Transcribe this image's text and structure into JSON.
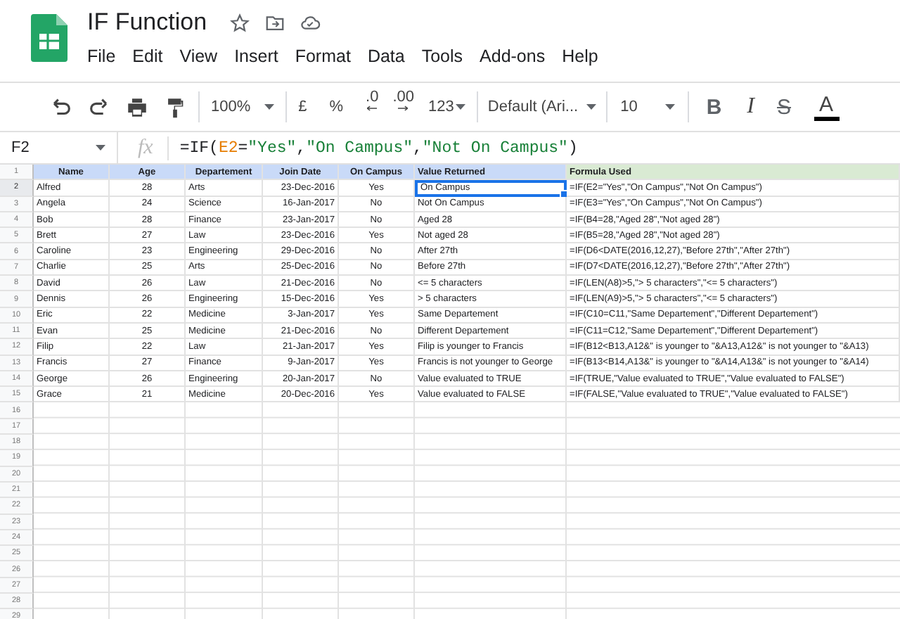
{
  "window": {
    "title": "IF Function"
  },
  "menu": [
    "File",
    "Edit",
    "View",
    "Insert",
    "Format",
    "Data",
    "Tools",
    "Add-ons",
    "Help"
  ],
  "toolbar": {
    "zoom": "100%",
    "currency": "£",
    "percent": "%",
    "decimal_decrease": ".0",
    "decimal_increase": ".00",
    "number_format": "123",
    "font": "Default (Ari...",
    "font_size": "10",
    "bold": "B",
    "italic": "I",
    "strikethrough": "S",
    "text_color": "A"
  },
  "formula_bar": {
    "cell_ref": "F2",
    "fx": "fx",
    "tokens": [
      {
        "kind": "plain",
        "text": "=IF("
      },
      {
        "kind": "ref",
        "text": "E2"
      },
      {
        "kind": "plain",
        "text": "="
      },
      {
        "kind": "string",
        "text": "\"Yes\""
      },
      {
        "kind": "plain",
        "text": ","
      },
      {
        "kind": "string",
        "text": "\"On Campus\""
      },
      {
        "kind": "plain",
        "text": ","
      },
      {
        "kind": "string",
        "text": "\"Not On Campus\""
      },
      {
        "kind": "plain",
        "text": ")"
      }
    ]
  },
  "sheet": {
    "header_row": "1",
    "columns": [
      {
        "label": "Name",
        "kind": "text",
        "color": "#c9daf8"
      },
      {
        "label": "Age",
        "kind": "number",
        "color": "#c9daf8"
      },
      {
        "label": "Departement",
        "kind": "text",
        "color": "#c9daf8"
      },
      {
        "label": "Join Date",
        "kind": "date",
        "color": "#c9daf8"
      },
      {
        "label": "On Campus",
        "kind": "flag",
        "color": "#c9daf8"
      },
      {
        "label": "Value Returned",
        "kind": "result",
        "color": "#c9daf8"
      },
      {
        "label": "Formula Used",
        "kind": "formula",
        "color": "#d9ead3"
      }
    ],
    "rows": [
      {
        "number": "2",
        "cells": [
          {
            "text": "Alfred",
            "selected": false
          },
          {
            "text": "28",
            "selected": false
          },
          {
            "text": "Arts",
            "selected": false
          },
          {
            "text": "23-Dec-2016",
            "selected": false
          },
          {
            "text": "Yes",
            "selected": false
          },
          {
            "text": "On Campus",
            "selected": true
          },
          {
            "text": "=IF(E2=\"Yes\",\"On Campus\",\"Not On Campus\")",
            "selected": false
          }
        ]
      },
      {
        "number": "3",
        "cells": [
          {
            "text": "Angela",
            "selected": false
          },
          {
            "text": "24",
            "selected": false
          },
          {
            "text": "Science",
            "selected": false
          },
          {
            "text": "16-Jan-2017",
            "selected": false
          },
          {
            "text": "No",
            "selected": false
          },
          {
            "text": "Not On Campus",
            "selected": false
          },
          {
            "text": "=IF(E3=\"Yes\",\"On Campus\",\"Not On Campus\")",
            "selected": false
          }
        ]
      },
      {
        "number": "4",
        "cells": [
          {
            "text": "Bob",
            "selected": false
          },
          {
            "text": "28",
            "selected": false
          },
          {
            "text": "Finance",
            "selected": false
          },
          {
            "text": "23-Jan-2017",
            "selected": false
          },
          {
            "text": "No",
            "selected": false
          },
          {
            "text": "Aged 28",
            "selected": false
          },
          {
            "text": "=IF(B4=28,\"Aged 28\",\"Not aged 28\")",
            "selected": false
          }
        ]
      },
      {
        "number": "5",
        "cells": [
          {
            "text": "Brett",
            "selected": false
          },
          {
            "text": "27",
            "selected": false
          },
          {
            "text": "Law",
            "selected": false
          },
          {
            "text": "23-Dec-2016",
            "selected": false
          },
          {
            "text": "Yes",
            "selected": false
          },
          {
            "text": "Not aged 28",
            "selected": false
          },
          {
            "text": "=IF(B5=28,\"Aged 28\",\"Not aged 28\")",
            "selected": false
          }
        ]
      },
      {
        "number": "6",
        "cells": [
          {
            "text": "Caroline",
            "selected": false
          },
          {
            "text": "23",
            "selected": false
          },
          {
            "text": "Engineering",
            "selected": false
          },
          {
            "text": "29-Dec-2016",
            "selected": false
          },
          {
            "text": "No",
            "selected": false
          },
          {
            "text": "After 27th",
            "selected": false
          },
          {
            "text": "=IF(D6<DATE(2016,12,27),\"Before 27th\",\"After 27th\")",
            "selected": false
          }
        ]
      },
      {
        "number": "7",
        "cells": [
          {
            "text": "Charlie",
            "selected": false
          },
          {
            "text": "25",
            "selected": false
          },
          {
            "text": "Arts",
            "selected": false
          },
          {
            "text": "25-Dec-2016",
            "selected": false
          },
          {
            "text": "No",
            "selected": false
          },
          {
            "text": "Before 27th",
            "selected": false
          },
          {
            "text": "=IF(D7<DATE(2016,12,27),\"Before 27th\",\"After 27th\")",
            "selected": false
          }
        ]
      },
      {
        "number": "8",
        "cells": [
          {
            "text": "David",
            "selected": false
          },
          {
            "text": "26",
            "selected": false
          },
          {
            "text": "Law",
            "selected": false
          },
          {
            "text": "21-Dec-2016",
            "selected": false
          },
          {
            "text": "No",
            "selected": false
          },
          {
            "text": "<= 5 characters",
            "selected": false
          },
          {
            "text": "=IF(LEN(A8)>5,\"> 5 characters\",\"<= 5 characters\")",
            "selected": false
          }
        ]
      },
      {
        "number": "9",
        "cells": [
          {
            "text": "Dennis",
            "selected": false
          },
          {
            "text": "26",
            "selected": false
          },
          {
            "text": "Engineering",
            "selected": false
          },
          {
            "text": "15-Dec-2016",
            "selected": false
          },
          {
            "text": "Yes",
            "selected": false
          },
          {
            "text": "> 5 characters",
            "selected": false
          },
          {
            "text": "=IF(LEN(A9)>5,\"> 5 characters\",\"<= 5 characters\")",
            "selected": false
          }
        ]
      },
      {
        "number": "10",
        "cells": [
          {
            "text": "Eric",
            "selected": false
          },
          {
            "text": "22",
            "selected": false
          },
          {
            "text": "Medicine",
            "selected": false
          },
          {
            "text": "3-Jan-2017",
            "selected": false
          },
          {
            "text": "Yes",
            "selected": false
          },
          {
            "text": "Same Departement",
            "selected": false
          },
          {
            "text": "=IF(C10=C11,\"Same Departement\",\"Different Departement\")",
            "selected": false
          }
        ]
      },
      {
        "number": "11",
        "cells": [
          {
            "text": "Evan",
            "selected": false
          },
          {
            "text": "25",
            "selected": false
          },
          {
            "text": "Medicine",
            "selected": false
          },
          {
            "text": "21-Dec-2016",
            "selected": false
          },
          {
            "text": "No",
            "selected": false
          },
          {
            "text": "Different Departement",
            "selected": false
          },
          {
            "text": "=IF(C11=C12,\"Same Departement\",\"Different Departement\")",
            "selected": false
          }
        ]
      },
      {
        "number": "12",
        "cells": [
          {
            "text": "Filip",
            "selected": false
          },
          {
            "text": "22",
            "selected": false
          },
          {
            "text": "Law",
            "selected": false
          },
          {
            "text": "21-Jan-2017",
            "selected": false
          },
          {
            "text": "Yes",
            "selected": false
          },
          {
            "text": "Filip is younger to Francis",
            "selected": false
          },
          {
            "text": "=IF(B12<B13,A12&\" is younger to \"&A13,A12&\" is not younger to \"&A13)",
            "selected": false
          }
        ]
      },
      {
        "number": "13",
        "cells": [
          {
            "text": "Francis",
            "selected": false
          },
          {
            "text": "27",
            "selected": false
          },
          {
            "text": "Finance",
            "selected": false
          },
          {
            "text": "9-Jan-2017",
            "selected": false
          },
          {
            "text": "Yes",
            "selected": false
          },
          {
            "text": "Francis is not younger to George",
            "selected": false
          },
          {
            "text": "=IF(B13<B14,A13&\" is younger to \"&A14,A13&\" is not younger to \"&A14)",
            "selected": false
          }
        ]
      },
      {
        "number": "14",
        "cells": [
          {
            "text": "George",
            "selected": false
          },
          {
            "text": "26",
            "selected": false
          },
          {
            "text": "Engineering",
            "selected": false
          },
          {
            "text": "20-Jan-2017",
            "selected": false
          },
          {
            "text": "No",
            "selected": false
          },
          {
            "text": "Value evaluated to TRUE",
            "selected": false
          },
          {
            "text": "=IF(TRUE,\"Value evaluated to TRUE\",\"Value evaluated to FALSE\")",
            "selected": false
          }
        ]
      },
      {
        "number": "15",
        "cells": [
          {
            "text": "Grace",
            "selected": false
          },
          {
            "text": "21",
            "selected": false
          },
          {
            "text": "Medicine",
            "selected": false
          },
          {
            "text": "20-Dec-2016",
            "selected": false
          },
          {
            "text": "Yes",
            "selected": false
          },
          {
            "text": "Value evaluated to FALSE",
            "selected": false
          },
          {
            "text": "=IF(FALSE,\"Value evaluated to TRUE\",\"Value evaluated to FALSE\")",
            "selected": false
          }
        ]
      }
    ],
    "blank_rows": [
      "16",
      "17",
      "18",
      "19",
      "20",
      "21",
      "22",
      "23",
      "24",
      "25",
      "26",
      "27",
      "28",
      "29"
    ]
  }
}
